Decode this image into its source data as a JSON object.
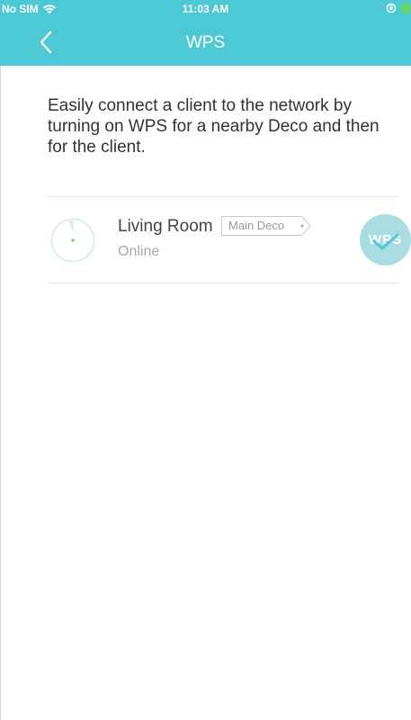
{
  "status_bar": {
    "carrier": "No SIM",
    "time": "11:03 AM",
    "icons": [
      "wifi-icon",
      "orientation-lock-icon",
      "battery-icon"
    ]
  },
  "nav": {
    "title": "WPS",
    "back_icon": "chevron-left-icon"
  },
  "description": "Easily connect a client to the network by turning on WPS for a nearby Deco and then for the client.",
  "devices": [
    {
      "name": "Living Room",
      "tag": "Main Deco",
      "status": "Online",
      "button_label": "WPS",
      "icon": "deco-device-icon",
      "selected_icon": "checkmark-icon"
    }
  ],
  "colors": {
    "header": "#4dc9d6",
    "wps_button": "#a8dde4",
    "check": "#4dc9d6",
    "online_dot": "#7ed957"
  }
}
